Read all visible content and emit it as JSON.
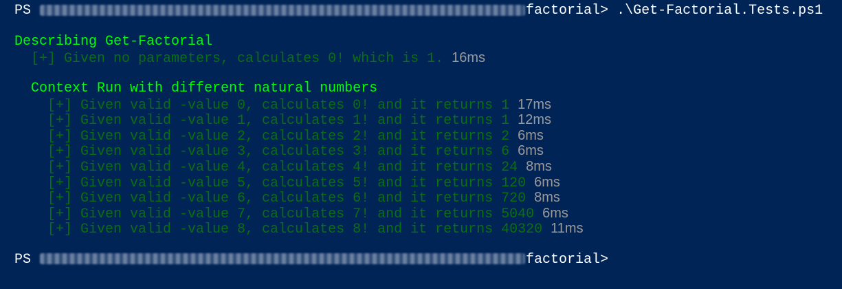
{
  "terminal": {
    "prompt_prefix": "PS",
    "first_prompt": {
      "path_tail": "factorial>",
      "command": " .\\Get-Factorial.Tests.ps1"
    },
    "describe": "Describing Get-Factorial",
    "first_test": {
      "text": "[+] Given no parameters, calculates 0! which is 1.",
      "time": "16ms"
    },
    "context": "Context Run with different natural numbers",
    "tests": [
      {
        "text": "[+] Given valid -value 0, calculates 0! and it returns 1",
        "time": "17ms"
      },
      {
        "text": "[+] Given valid -value 1, calculates 1! and it returns 1",
        "time": "12ms"
      },
      {
        "text": "[+] Given valid -value 2, calculates 2! and it returns 2",
        "time": "6ms"
      },
      {
        "text": "[+] Given valid -value 3, calculates 3! and it returns 6",
        "time": "6ms"
      },
      {
        "text": "[+] Given valid -value 4, calculates 4! and it returns 24",
        "time": "8ms"
      },
      {
        "text": "[+] Given valid -value 5, calculates 5! and it returns 120",
        "time": "6ms"
      },
      {
        "text": "[+] Given valid -value 6, calculates 6! and it returns 720",
        "time": "8ms"
      },
      {
        "text": "[+] Given valid -value 7, calculates 7! and it returns 5040",
        "time": "6ms"
      },
      {
        "text": "[+] Given valid -value 8, calculates 8! and it returns 40320",
        "time": "11ms"
      }
    ],
    "second_prompt": {
      "path_tail": "factorial>"
    },
    "colors": {
      "background": "#012456",
      "heading_green": "#00ff00",
      "pass_green": "#0a6f0f",
      "timing_gray": "#9a9a9a"
    }
  }
}
